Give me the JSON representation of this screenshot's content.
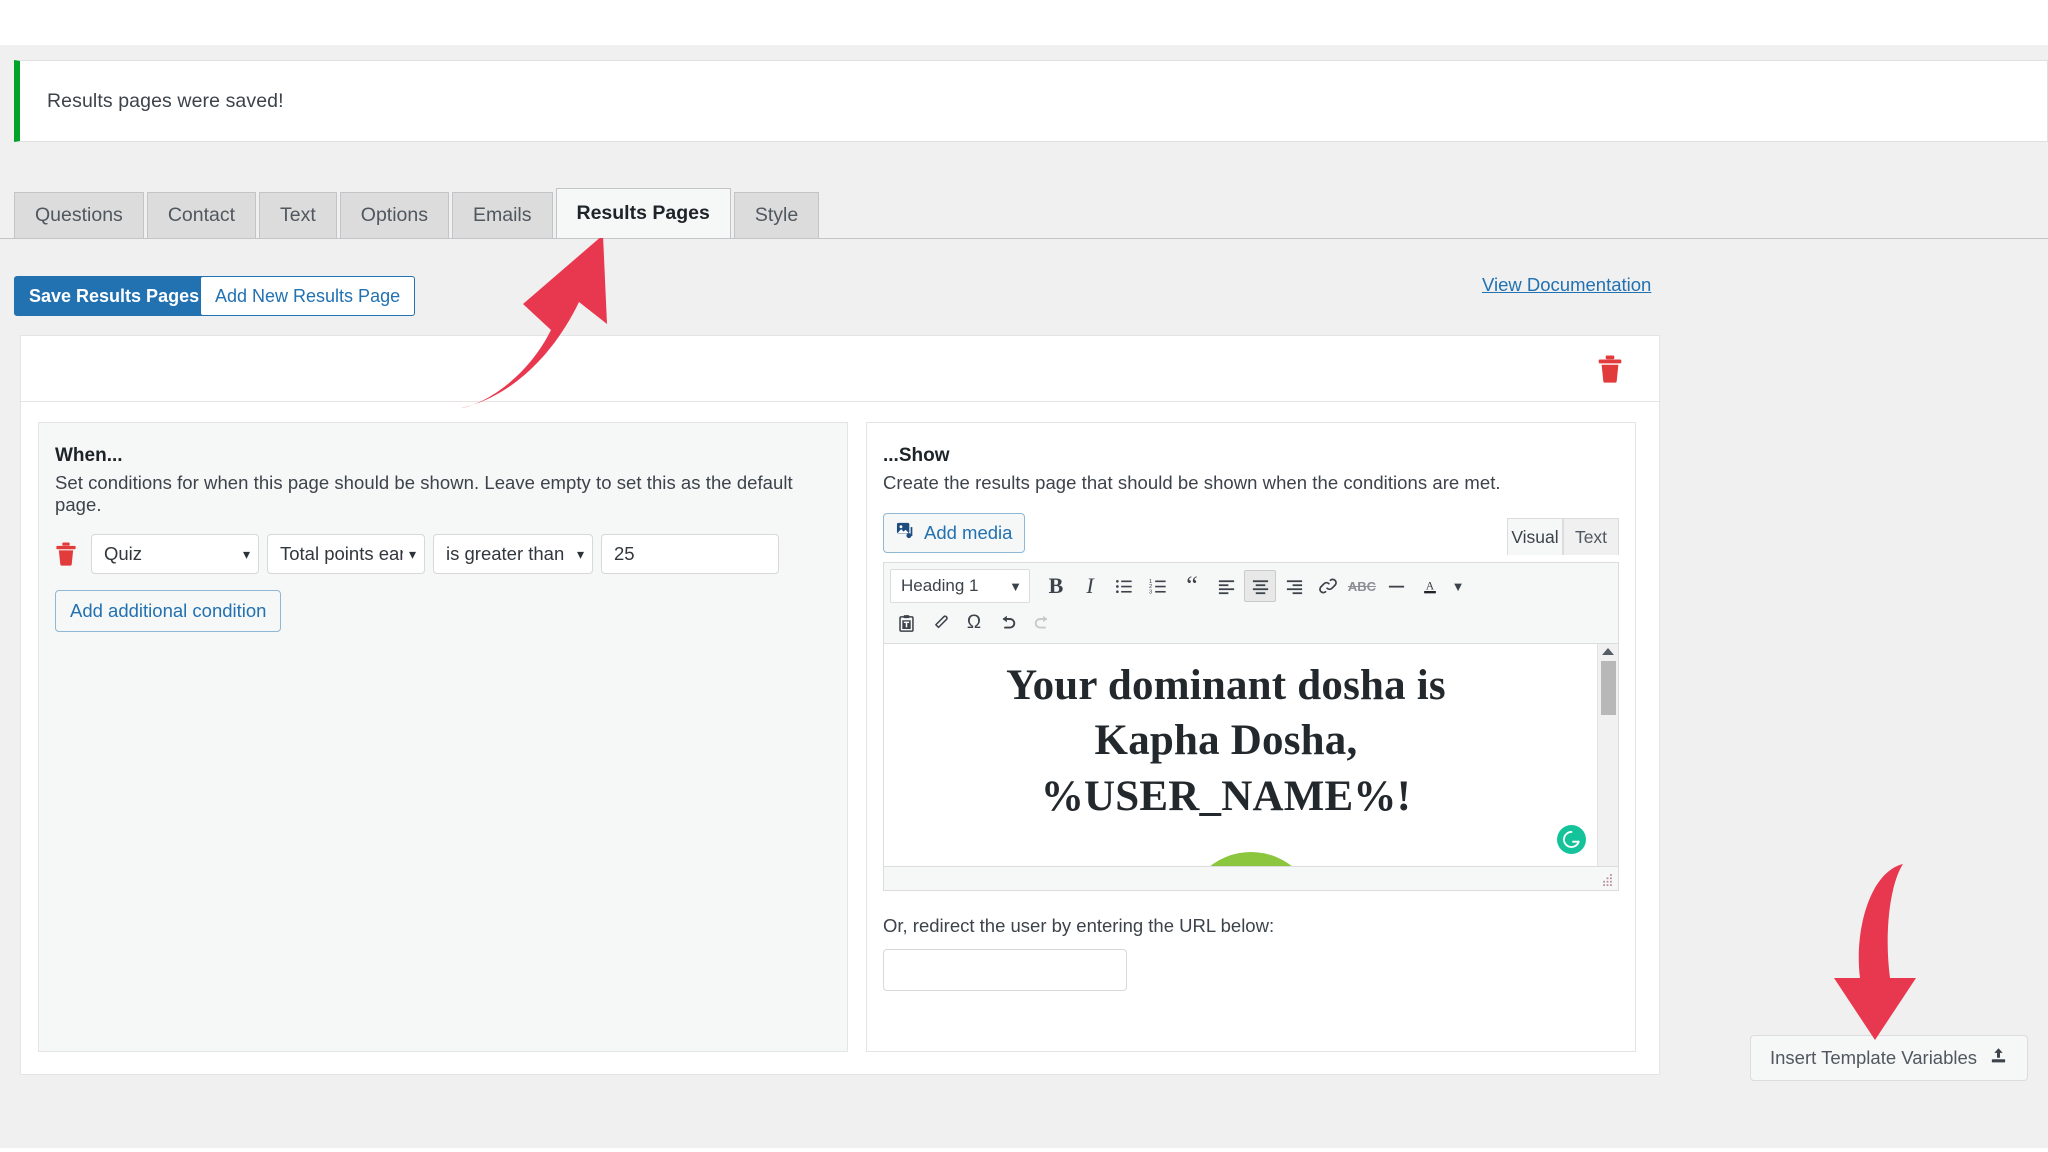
{
  "notice": {
    "message": "Results pages were saved!",
    "accent_color": "#00a32a"
  },
  "tabs": [
    {
      "label": "Questions",
      "active": false
    },
    {
      "label": "Contact",
      "active": false
    },
    {
      "label": "Text",
      "active": false
    },
    {
      "label": "Options",
      "active": false
    },
    {
      "label": "Emails",
      "active": false
    },
    {
      "label": "Results Pages",
      "active": true
    },
    {
      "label": "Style",
      "active": false
    }
  ],
  "actions": {
    "save_label": "Save Results Pages",
    "add_new_label": "Add New Results Page",
    "documentation_label": "View Documentation",
    "primary_color": "#2271b1"
  },
  "results_page_card": {
    "delete_icon": "trash-icon",
    "when": {
      "title": "When...",
      "description": "Set conditions for when this page should be shown. Leave empty to set this as the default page.",
      "condition": {
        "delete_icon": "trash-icon",
        "source": "Quiz",
        "field": "Total points earned",
        "field_display": "Total points ear",
        "operator": "is greater than",
        "value": "25"
      },
      "add_condition_label": "Add additional condition"
    },
    "show": {
      "title": "...Show",
      "description": "Create the results page that should be shown when the conditions are met.",
      "add_media_label": "Add media",
      "editor_mode_tabs": [
        {
          "label": "Visual",
          "active": true
        },
        {
          "label": "Text",
          "active": false
        }
      ],
      "toolbar": {
        "format_select": "Heading 1",
        "row1": [
          "bold-icon",
          "italic-icon",
          "bulleted-list-icon",
          "numbered-list-icon",
          "blockquote-icon",
          "align-left-icon",
          "align-center-icon",
          "align-right-icon",
          "link-icon",
          "strikethrough-icon",
          "horizontal-rule-icon",
          "text-color-icon",
          "text-color-chevron-icon"
        ],
        "row2": [
          "paste-as-text-icon",
          "clear-formatting-icon",
          "special-character-icon",
          "undo-icon",
          "redo-icon"
        ],
        "active_button": "align-center-icon",
        "disabled_button": "redo-icon"
      },
      "content": {
        "heading_lines": [
          "Your dominant dosha is",
          "Kapha Dosha,",
          "%USER_NAME%!"
        ],
        "image_alt": "dosha-illustration",
        "image_colors": [
          "#8cc63f",
          "#5a4a3f",
          "#1b9dc4",
          "#38a9e0",
          "#d7df23"
        ]
      },
      "grammarly_badge": "G",
      "redirect_label": "Or, redirect the user by entering the URL below:",
      "redirect_value": "",
      "redirect_placeholder": ""
    }
  },
  "template_variables": {
    "label": "Insert Template Variables",
    "icon": "upload-icon"
  },
  "annotations": {
    "arrow_color": "#e8384f",
    "arrows": [
      {
        "name": "arrow-to-results-pages-tab",
        "direction": "up-right"
      },
      {
        "name": "arrow-to-insert-template-variables",
        "direction": "down"
      }
    ]
  }
}
